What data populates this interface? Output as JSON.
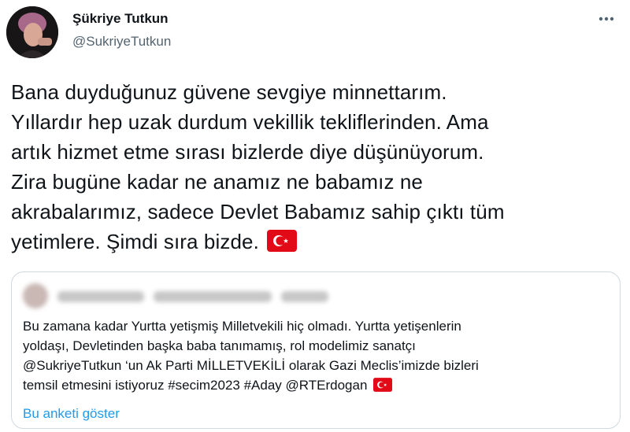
{
  "author": {
    "display_name": "Şükriye Tutkun",
    "handle": "@SukriyeTutkun"
  },
  "tweet": {
    "lines": [
      "Bana duyduğunuz güvene sevgiye minnettarım.",
      "Yıllardır hep uzak durdum vekillik tekliflerinden. Ama",
      "artık hizmet etme sırası bizlerde diye düşünüyorum.",
      "Zira bugüne kadar ne anamız ne babamız ne",
      "akrabalarımız, sadece Devlet Babamız sahip çıktı tüm",
      "yetimlere. Şimdi sıra bizde."
    ],
    "emoji": "turkey-flag-icon"
  },
  "quoted_tweet": {
    "lines": [
      "Bu zamana kadar Yurtta yetişmiş Milletvekili hiç olmadı. Yurtta yetişenlerin",
      "yoldaşı, Devletinden başka baba tanımamış, rol modelimiz sanatçı",
      "@SukriyeTutkun ‘un Ak Parti MİLLETVEKİLİ olarak  Gazi Meclis’imizde bizleri",
      "temsil etmesini istiyoruz #secim2023 #Aday @RTErdogan"
    ],
    "emoji": "turkey-flag-icon",
    "poll_link": "Bu anketi göster"
  },
  "colors": {
    "text": "#0f1419",
    "secondary": "#536471",
    "link": "#1d9bf0",
    "border": "#cfd9de",
    "flag_red": "#e30a17"
  }
}
